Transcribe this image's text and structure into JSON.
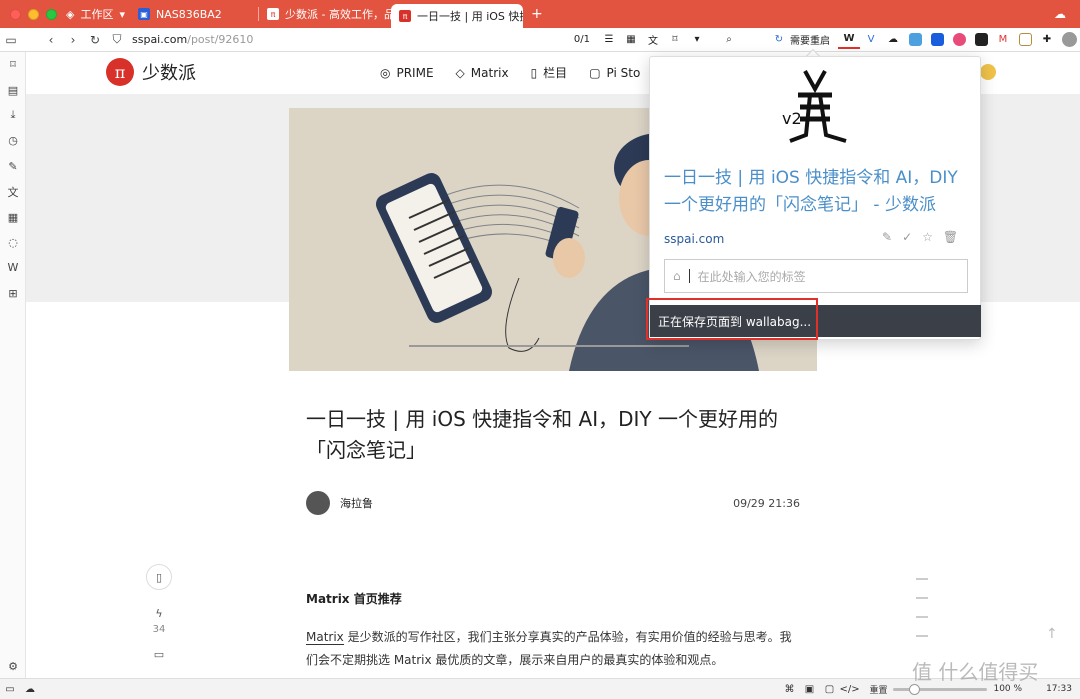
{
  "tabs": [
    {
      "label": "工作区",
      "icon": "layers-icon"
    },
    {
      "label": "NAS836BA2",
      "icon": "nas-favicon"
    },
    {
      "label": "少数派 - 高效工作，品质生",
      "icon": "sspai-favicon"
    },
    {
      "label": "一日一技 | 用 iOS 快捷指令",
      "icon": "sspai-favicon",
      "active": true
    }
  ],
  "address": {
    "domain": "sspai.com",
    "path": "/post/92610",
    "find_count": "0/1",
    "restart_label": "需要重启"
  },
  "nav": {
    "logo_text": "少数派",
    "menu": [
      "PRIME",
      "Matrix",
      "栏目",
      "Pi Sto"
    ]
  },
  "article": {
    "title": "一日一技 | 用 iOS 快捷指令和 AI，DIY 一个更好用的「闪念笔记」",
    "author": "海拉鲁",
    "date": "09/29 21:36",
    "like_count": "34",
    "section_heading": "Matrix 首页推荐",
    "para_link": "Matrix",
    "para_text": " 是少数派的写作社区，我们主张分享真实的产品体验，有实用价值的经验与思考。我们会不定期挑选 Matrix 最优质的文章，展示来自用户的最真实的体验和观点。"
  },
  "popup": {
    "logo_label": "v2",
    "title": "一日一技 | 用 iOS 快捷指令和 AI，DIY 一个更好用的「闪念笔记」 - 少数派",
    "domain": "sspai.com",
    "tag_placeholder": "在此处输入您的标签",
    "saving_message": "正在保存页面到 wallabag..."
  },
  "status": {
    "zoom_label": "重置",
    "zoom": "100 %",
    "time": "17:33"
  },
  "watermark": "值 什么值得买",
  "colors": {
    "tabbar": "#e25440",
    "accent": "#d7312a",
    "popup_title": "#4a8fc9",
    "saving_bar": "#3b3f48"
  }
}
